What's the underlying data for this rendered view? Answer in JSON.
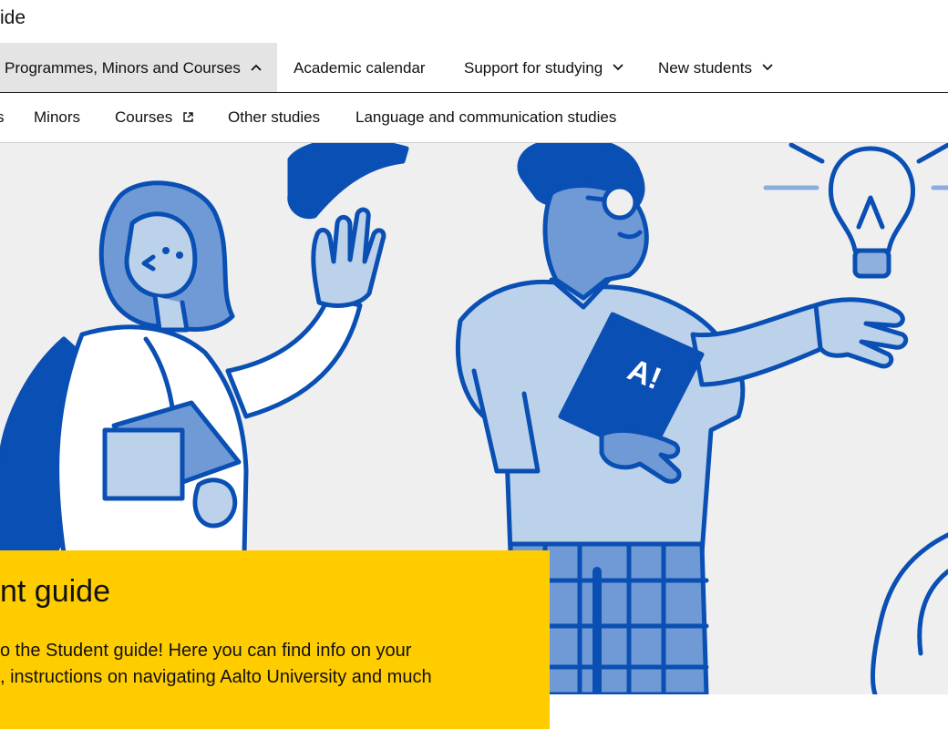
{
  "header": {
    "site_title": "ide"
  },
  "main_nav": {
    "items": [
      {
        "label": "Programmes, Minors and Courses",
        "state": "expanded"
      },
      {
        "label": "Academic calendar"
      },
      {
        "label": "Support for studying",
        "state": "collapsed"
      },
      {
        "label": "New students",
        "state": "collapsed"
      }
    ]
  },
  "sub_nav": {
    "items": [
      {
        "label": "s"
      },
      {
        "label": "Minors"
      },
      {
        "label": "Courses",
        "icon": "external-link-icon"
      },
      {
        "label": "Other studies"
      },
      {
        "label": "Language and communication studies"
      }
    ]
  },
  "hero": {
    "illustration": "students-illustration",
    "book_badge": "A!",
    "colors": {
      "dark_blue": "#0a4fb3",
      "mid_blue": "#6f9ad6",
      "light_blue": "#bcd1ea",
      "background": "#efefef"
    }
  },
  "hero_card": {
    "title": "nt guide",
    "intro_line1": "o the Student guide! Here you can find info on your",
    "intro_line2": ", instructions on navigating Aalto University and much",
    "background": "#ffcc00"
  }
}
